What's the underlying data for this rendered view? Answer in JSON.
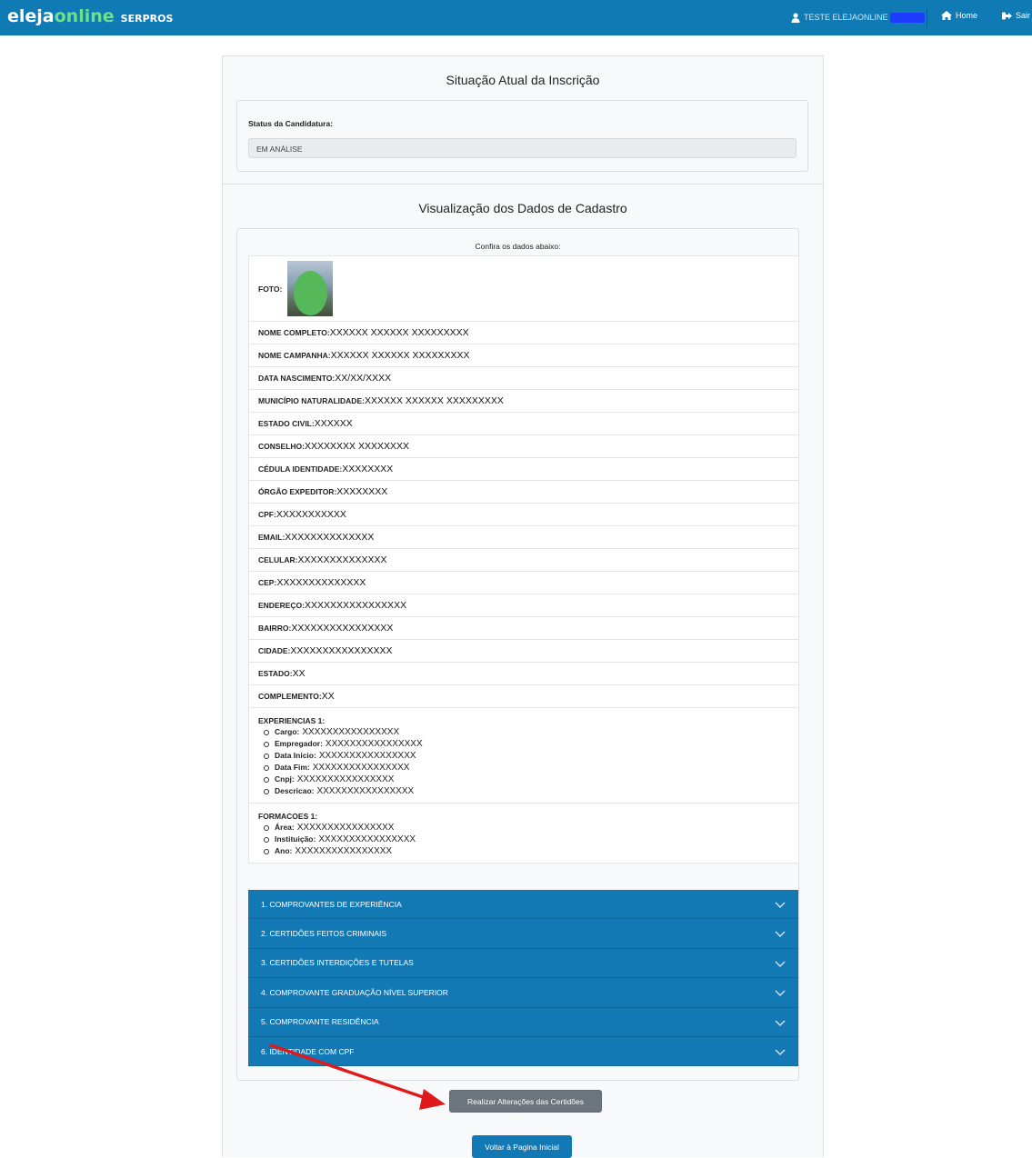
{
  "header": {
    "brand_main": "eleja",
    "brand_accent": "online",
    "brand_sub": "SERPROS",
    "user_name": "TESTE ELEJAONLINE",
    "home_label": "Home",
    "logout_label": "Sair",
    "colors": {
      "bar": "#0f7ab3",
      "accent": "#6ee08a"
    }
  },
  "status_section": {
    "title": "Situação Atual da Inscrição",
    "label": "Status da Candidatura:",
    "value": "EM ANÁLISE"
  },
  "cadastro_section": {
    "title": "Visualização dos Dados de Cadastro",
    "instruction": "Confira os dados abaixo:",
    "foto_label": "FOTO:",
    "fields": [
      {
        "label": "NOME COMPLETO:",
        "value": "XXXXXX XXXXXX XXXXXXXXX"
      },
      {
        "label": "NOME CAMPANHA:",
        "value": "XXXXXX XXXXXX XXXXXXXXX"
      },
      {
        "label": "DATA NASCIMENTO:",
        "value": "XX/XX/XXXX"
      },
      {
        "label": "MUNICÍPIO NATURALIDADE:",
        "value": "XXXXXX XXXXXX XXXXXXXXX"
      },
      {
        "label": "ESTADO CIVIL:",
        "value": "XXXXXX"
      },
      {
        "label": "CONSELHO:",
        "value": "XXXXXXXX  XXXXXXXX"
      },
      {
        "label": "CÉDULA IDENTIDADE:",
        "value": "XXXXXXXX"
      },
      {
        "label": "ÓRGÃO EXPEDITOR:",
        "value": "XXXXXXXX"
      },
      {
        "label": "CPF:",
        "value": "XXXXXXXXXXX"
      },
      {
        "label": "EMAIL:",
        "value": "XXXXXXXXXXXXXX"
      },
      {
        "label": "CELULAR:",
        "value": "XXXXXXXXXXXXXX"
      },
      {
        "label": "CEP:",
        "value": "XXXXXXXXXXXXXX"
      },
      {
        "label": "ENDEREÇO:",
        "value": "XXXXXXXXXXXXXXXX"
      },
      {
        "label": "BAIRRO:",
        "value": "XXXXXXXXXXXXXXXX"
      },
      {
        "label": "CIDADE:",
        "value": "XXXXXXXXXXXXXXXX"
      },
      {
        "label": "ESTADO:",
        "value": "XX"
      },
      {
        "label": "COMPLEMENTO:",
        "value": "XX"
      }
    ],
    "experiencias": {
      "label": "EXPERIENCIAS 1:",
      "items": [
        {
          "label": "Cargo:",
          "value": "XXXXXXXXXXXXXXXX"
        },
        {
          "label": "Empregador:",
          "value": "XXXXXXXXXXXXXXXX"
        },
        {
          "label": "Data Inicio:",
          "value": "XXXXXXXXXXXXXXXX"
        },
        {
          "label": "Data Fim:",
          "value": "XXXXXXXXXXXXXXXX"
        },
        {
          "label": "Cnpj:",
          "value": "XXXXXXXXXXXXXXXX"
        },
        {
          "label": "Descricao:",
          "value": "XXXXXXXXXXXXXXXX"
        }
      ]
    },
    "formacoes": {
      "label": "FORMACOES 1:",
      "items": [
        {
          "label": "Área:",
          "value": "XXXXXXXXXXXXXXXX"
        },
        {
          "label": "Instituição:",
          "value": "XXXXXXXXXXXXXXXX"
        },
        {
          "label": "Ano:",
          "value": "XXXXXXXXXXXXXXXX"
        }
      ]
    }
  },
  "accordion": [
    {
      "label": "1. COMPROVANTES DE EXPERIÊNCIA"
    },
    {
      "label": "2. CERTIDÕES FEITOS CRIMINAIS"
    },
    {
      "label": "3. CERTIDÕES INTERDIÇÕES E TUTELAS"
    },
    {
      "label": "4. COMPROVANTE GRADUAÇÃO NÍVEL SUPERIOR"
    },
    {
      "label": "5. COMPROVANTE RESIDÊNCIA"
    },
    {
      "label": "6. IDENTIDADE COM CPF"
    }
  ],
  "actions": {
    "alter_label": "Realizar Alterações das Certidões",
    "back_label": "Voltar à Pagina Inicial"
  },
  "annotation": {
    "arrow_color": "#e01a1a"
  }
}
